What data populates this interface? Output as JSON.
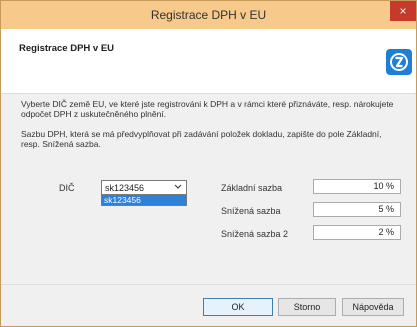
{
  "window": {
    "title": "Registrace DPH v EU",
    "close_glyph": "×"
  },
  "header": {
    "title": "Registrace DPH v EU",
    "logo_icon": "app-logo-icon"
  },
  "content": {
    "para1": "Vyberte DIČ země EU, ve které jste registrováni k DPH a v rámci které přiznáváte, resp. nárokujete odpočet DPH z uskutečněného plnění.",
    "para2": "Sazbu DPH, která se má předvyplňovat při zadávání položek dokladu, zapište do pole Základní, resp. Snížená sazba.",
    "dic_label": "DIČ",
    "dic_value": "sk123456",
    "dic_options": [
      "sk123456"
    ],
    "rates": [
      {
        "label": "Základní sazba",
        "value": "10 %"
      },
      {
        "label": "Snížená sazba",
        "value": "5 %"
      },
      {
        "label": "Snížená sazba 2",
        "value": "2 %"
      }
    ]
  },
  "footer": {
    "ok": "OK",
    "cancel": "Storno",
    "help": "Nápověda"
  },
  "colors": {
    "titlebar": "#f7c98a",
    "close": "#c7392a",
    "accent": "#2f80d8"
  }
}
